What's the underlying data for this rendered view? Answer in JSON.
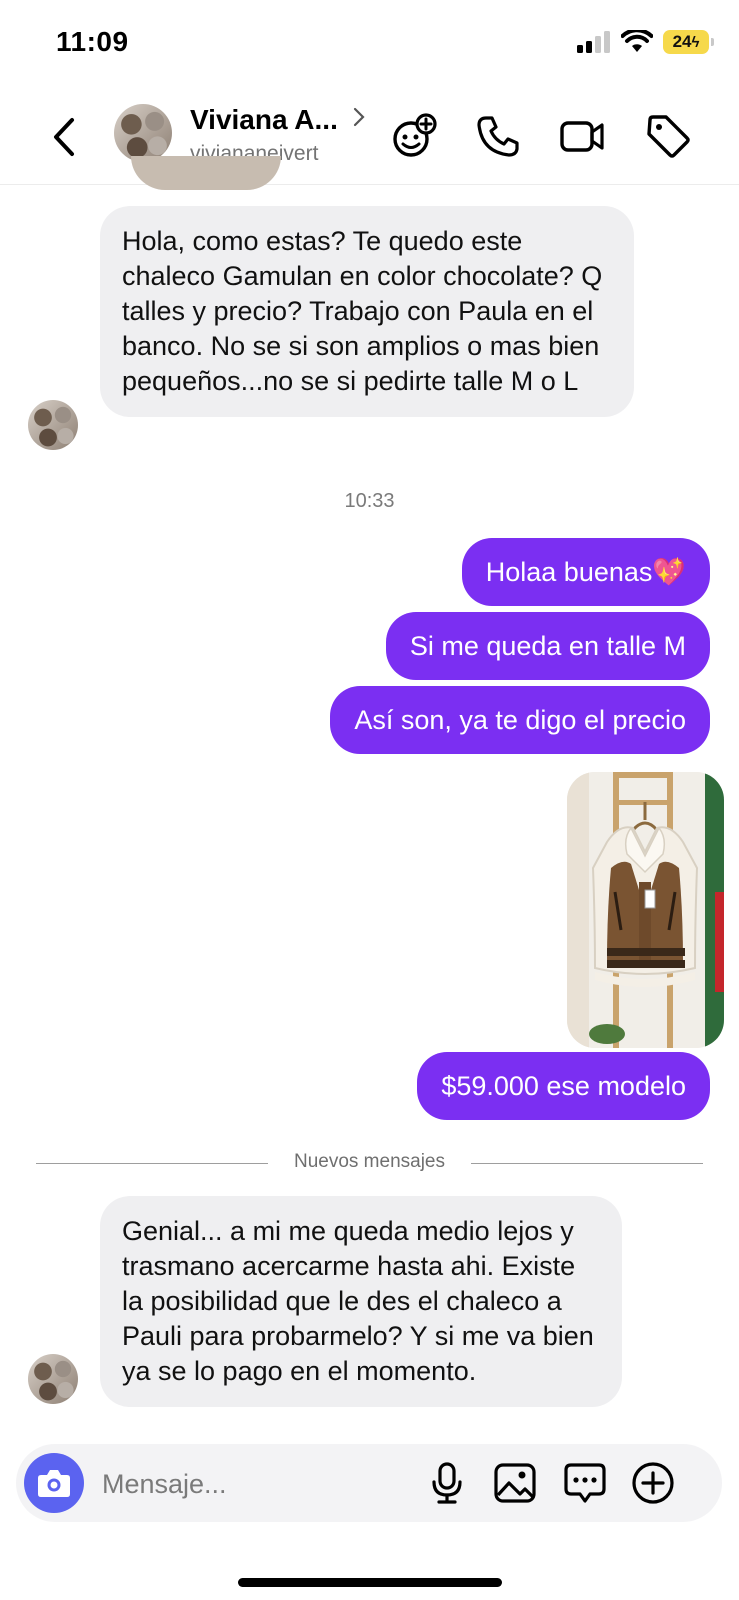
{
  "status_bar": {
    "time": "11:09",
    "battery": "24"
  },
  "header": {
    "contact_name": "Viviana A...",
    "contact_handle": "viviananeivert",
    "icons": [
      "back-icon",
      "sticker-icon",
      "phone-icon",
      "video-camera-icon",
      "tag-icon"
    ]
  },
  "chat": {
    "incoming_1": "Hola, como estas? Te quedo este chaleco Gamulan en color chocolate? Q talles y precio? Trabajo con Paula en el banco. No se si son amplios o mas bien pequeños...no se si pedirte talle M o L",
    "timestamp": "10:33",
    "outgoing": [
      "Holaa buenas💖",
      "Si me queda en talle M",
      "Así son, ya te digo el precio"
    ],
    "outgoing_price": "$59.000 ese modelo",
    "new_messages_divider": "Nuevos mensajes",
    "incoming_2": "Genial... a mi me queda medio lejos y trasmano acercarme hasta ahi. Existe la posibilidad que le des el chaleco a Pauli para probarmelo? Y si me va bien ya se lo pago en el momento."
  },
  "composer": {
    "placeholder": "Mensaje...",
    "icons": [
      "camera-icon",
      "microphone-icon",
      "gallery-icon",
      "chat-bubble-icon",
      "add-icon"
    ]
  },
  "colors": {
    "outgoing_bubble": "#7b2ff2",
    "incoming_bubble": "#efeff1",
    "camera_button": "#5b63f0",
    "battery": "#f6d94b"
  }
}
